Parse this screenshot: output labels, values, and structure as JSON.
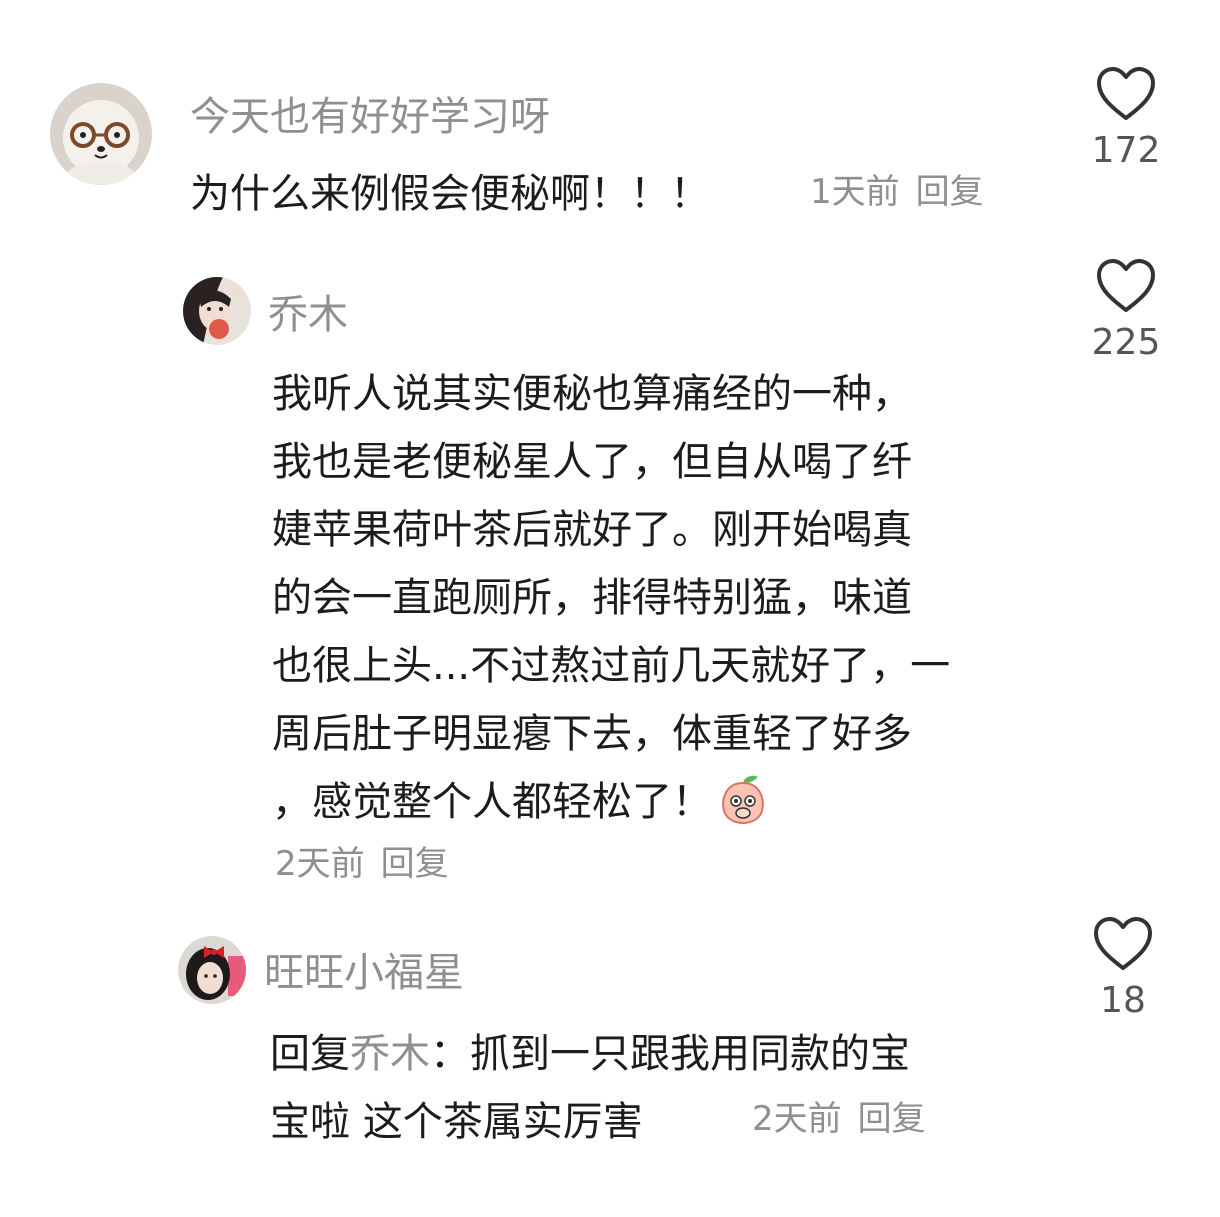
{
  "comments": [
    {
      "username": "今天也有好好学习呀",
      "text": "为什么来例假会便秘啊！！！",
      "time": "1天前",
      "reply_label": "回复",
      "likes": "172",
      "avatar_icon": "bear-with-glasses-avatar"
    },
    {
      "username": "乔木",
      "text_lines": [
        "我听人说其实便秘也算痛经的一种，",
        "我也是老便秘星人了，但自从喝了纤",
        "婕苹果荷叶茶后就好了。刚开始喝真",
        "的会一直跑厕所，排得特别猛，味道",
        "也很上头...不过熬过前几天就好了，一",
        "周后肚子明显瘪下去，体重轻了好多",
        "，感觉整个人都轻松了！"
      ],
      "emoji": "peach-shy-emoji",
      "time": "2天前",
      "reply_label": "回复",
      "likes": "225",
      "avatar_icon": "girl-holding-peach-avatar"
    },
    {
      "username": "旺旺小福星",
      "reply_prefix": "回复",
      "reply_to": "乔木",
      "text_line1": "：抓到一只跟我用同款的宝",
      "text_line2": "宝啦 这个茶属实厉害",
      "time": "2天前",
      "reply_label": "回复",
      "likes": "18",
      "avatar_icon": "girl-with-red-bow-avatar"
    }
  ],
  "colors": {
    "muted": "#8f8f8f",
    "text": "#1c1c1c",
    "heart_outline": "#333333"
  }
}
